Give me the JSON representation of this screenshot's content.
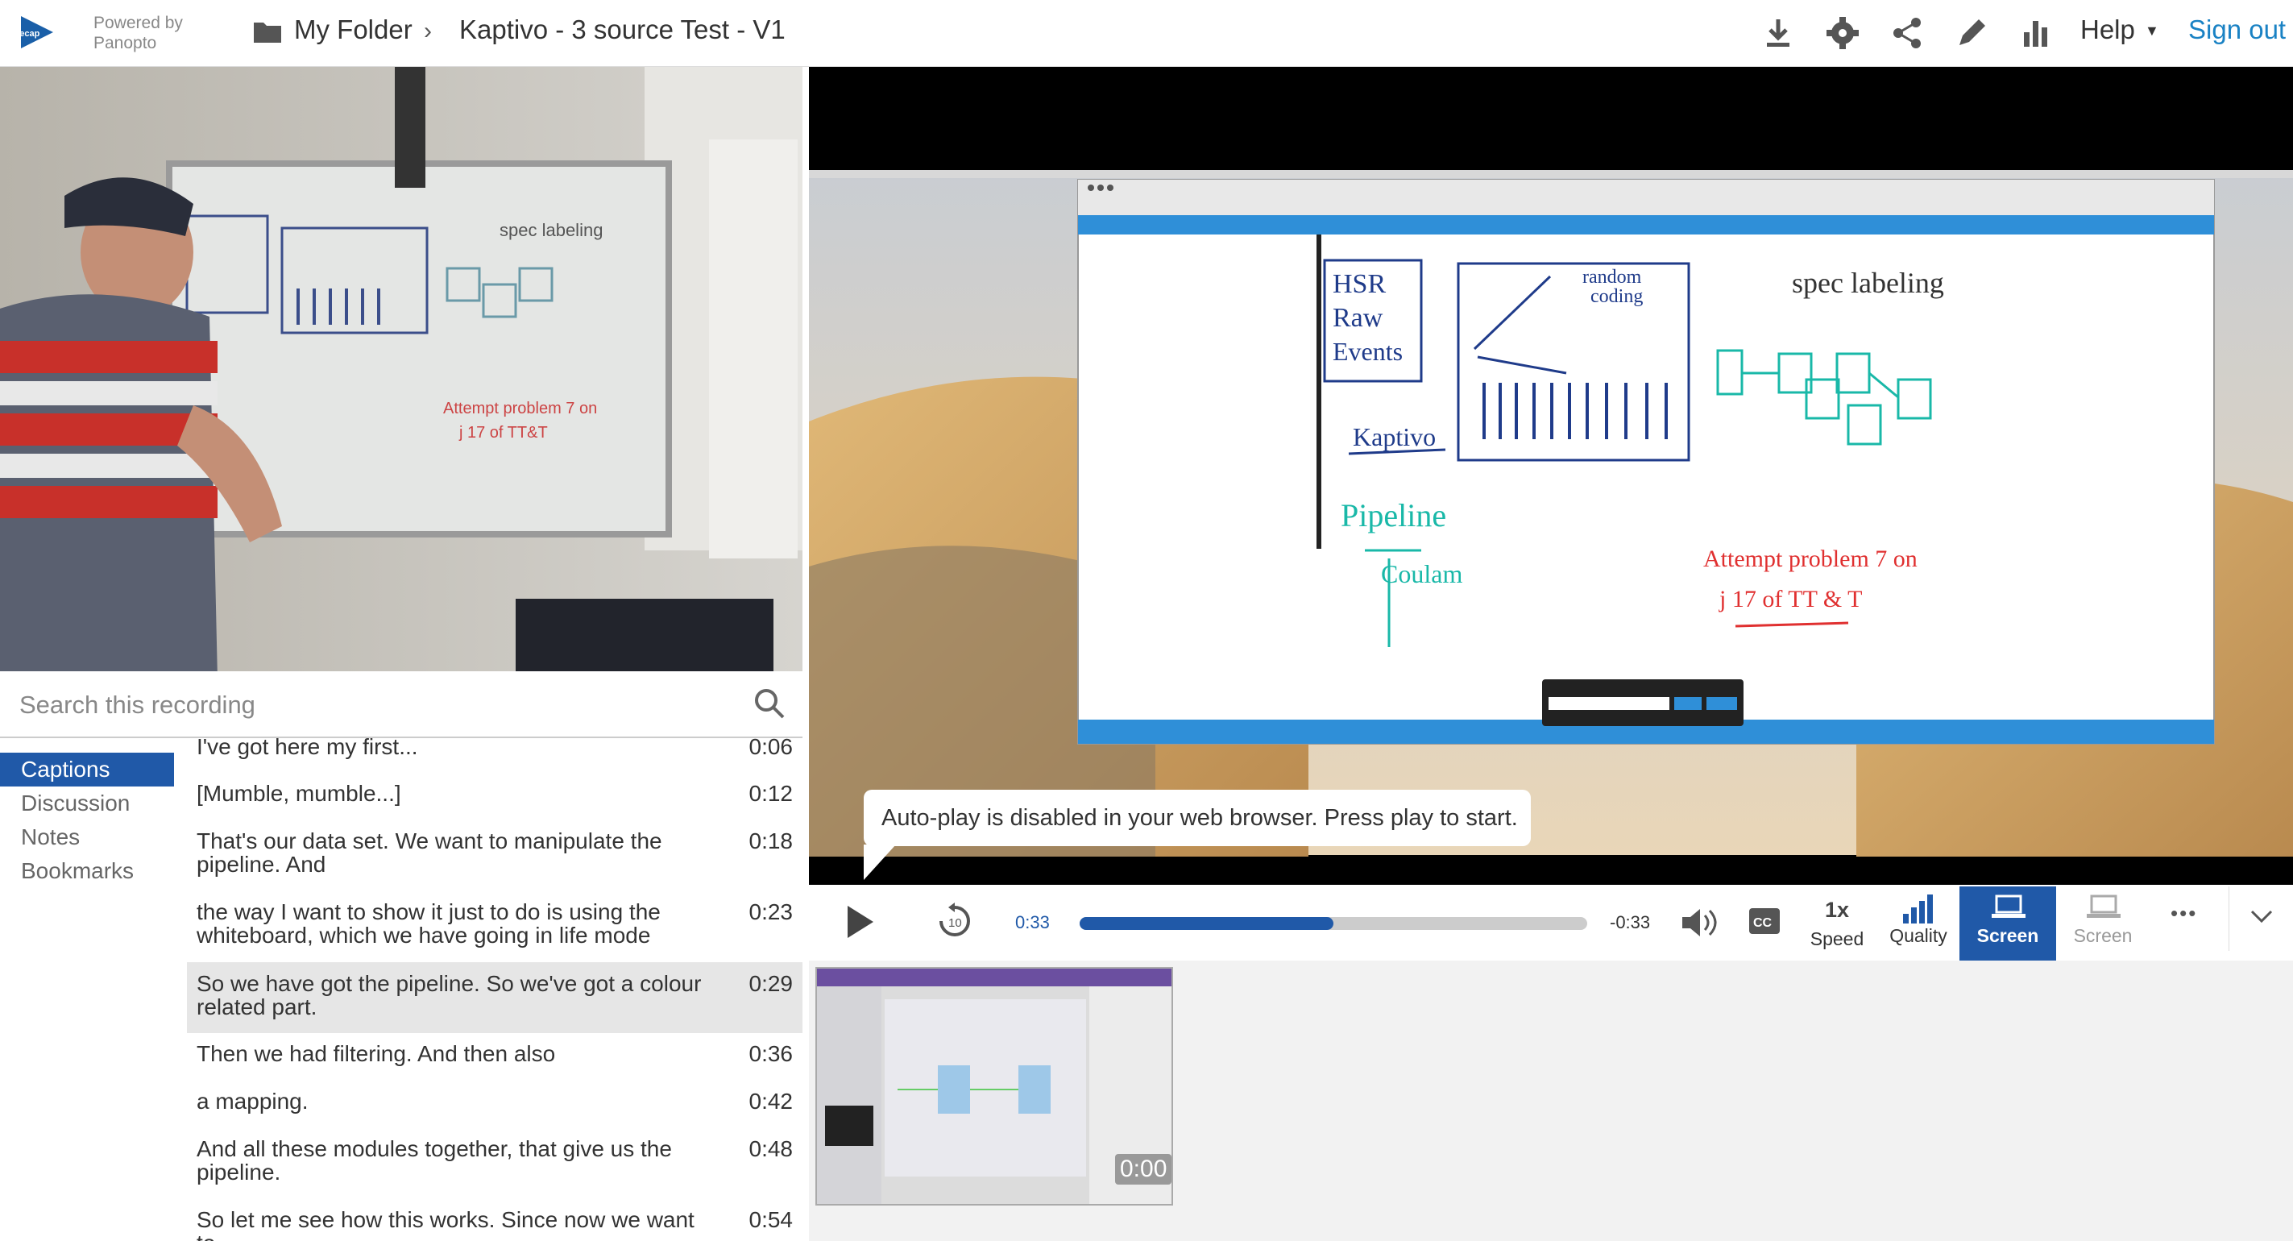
{
  "header": {
    "logo_text": "recap",
    "powered_by": [
      "Powered by",
      "Panopto"
    ],
    "breadcrumb_folder": "My Folder",
    "breadcrumb_separator": "›",
    "session_title": "Kaptivo - 3 source Test - V1",
    "icons": [
      "download-icon",
      "gear-icon",
      "share-icon",
      "pencil-icon",
      "stats-icon"
    ],
    "help_label": "Help",
    "signout_label": "Sign out"
  },
  "search": {
    "placeholder": "Search this recording"
  },
  "nav": {
    "items": [
      "Captions",
      "Discussion",
      "Notes",
      "Bookmarks"
    ],
    "active": "Captions"
  },
  "captions": [
    {
      "text": "I've got here my first...",
      "time": "0:06"
    },
    {
      "text": "[Mumble, mumble...]",
      "time": "0:12"
    },
    {
      "text": "That's our data set. We want to manipulate the pipeline. And",
      "time": "0:18"
    },
    {
      "text": "the way I want to show it just to do is using the whiteboard, which we have going in life mode",
      "time": "0:23"
    },
    {
      "text": "So we have got the pipeline. So we've got a colour related part.",
      "time": "0:29"
    },
    {
      "text": "Then we had filtering. And then also",
      "time": "0:36"
    },
    {
      "text": "a mapping.",
      "time": "0:42"
    },
    {
      "text": "And all these modules together, that give us the pipeline.",
      "time": "0:48"
    },
    {
      "text": "So let me see how this works. Since now we want to",
      "time": "0:54"
    }
  ],
  "whiteboard": {
    "labels": [
      "HSR",
      "Raw",
      "Events",
      "Kaptivo",
      "random",
      "coding",
      "spec labeling",
      "Pipeline",
      "Coulam",
      "Attempt problem 7 on",
      "j 17 of TT & T"
    ]
  },
  "player": {
    "autoplay_message": "Auto-play is disabled in your web browser. Press play to start.",
    "current_time": "0:33",
    "remaining_time": "-0:33",
    "progress": 0.5,
    "speed_value": "1x",
    "speed_label": "Speed",
    "quality_label": "Quality",
    "screen_active_label": "Screen",
    "screen_inactive_label": "Screen",
    "more_label": "•••",
    "thumb_time": "0:00"
  },
  "colors": {
    "accent": "#2059a8",
    "signout": "#1a82c4",
    "whiteboard_blue": "#1f3b8a",
    "whiteboard_teal": "#19b8a8",
    "whiteboard_red": "#e03030"
  }
}
